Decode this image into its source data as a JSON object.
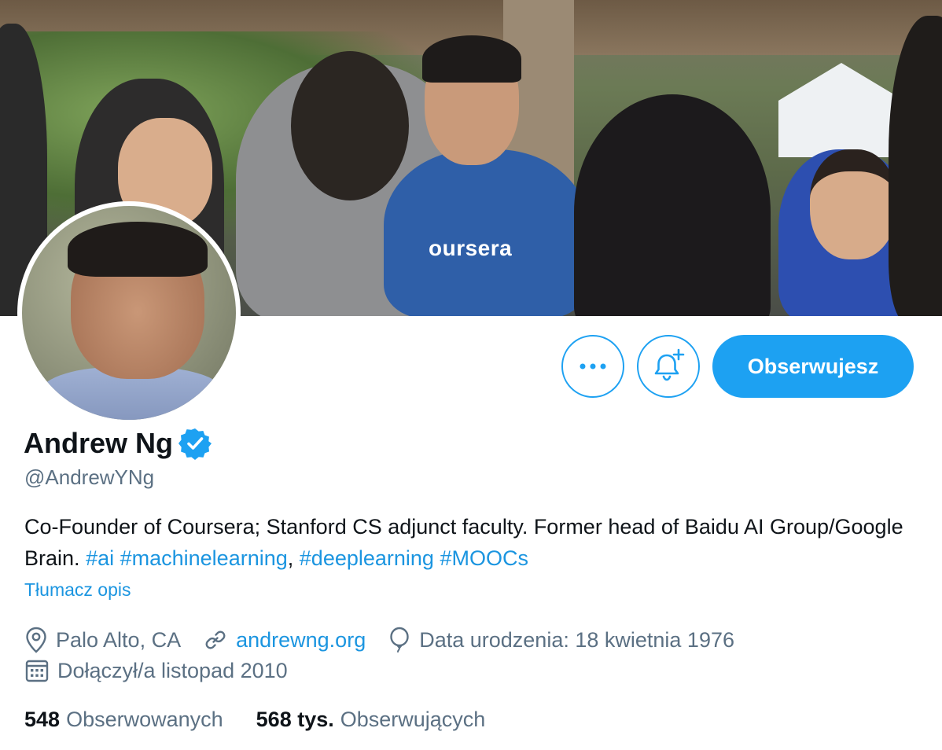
{
  "banner": {
    "shirt_text": "oursera"
  },
  "actions": {
    "more_icon": "more-horizontal-icon",
    "bell_icon": "bell-plus-icon",
    "follow_label": "Obserwujesz"
  },
  "profile": {
    "name": "Andrew Ng",
    "verified_icon": "verified-badge-icon",
    "handle": "@AndrewYNg",
    "bio_text_1": "Co-Founder of Coursera; Stanford CS adjunct faculty. Former head of Baidu AI Group/Google Brain.",
    "bio_tags": [
      "#ai",
      "#machinelearning",
      "#deeplearning",
      "#MOOCs"
    ],
    "bio_separator": ",",
    "translate_label": "Tłumacz opis"
  },
  "meta": {
    "location": "Palo Alto, CA",
    "website": "andrewng.org",
    "birthday": "Data urodzenia: 18 kwietnia 1976",
    "joined": "Dołączył/a listopad 2010"
  },
  "stats": {
    "following_count": "548",
    "following_label": "Obserwowanych",
    "followers_count": "568 tys.",
    "followers_label": "Obserwujących"
  },
  "colors": {
    "accent": "#1da1f2",
    "link": "#1b95e0",
    "secondary_text": "#5b7083"
  }
}
